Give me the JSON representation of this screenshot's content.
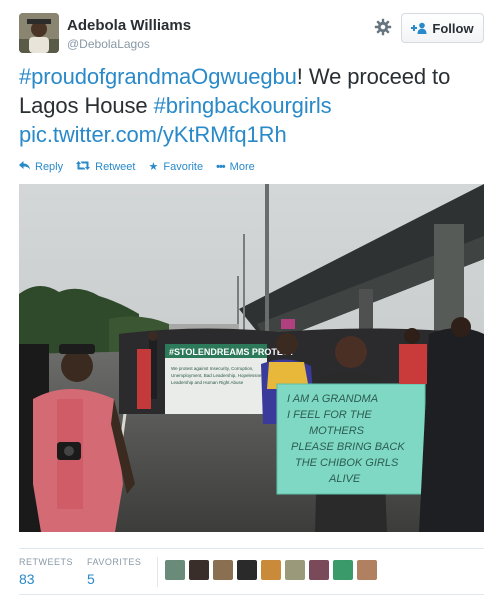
{
  "user": {
    "name": "Adebola Williams",
    "handle": "@DebolaLagos"
  },
  "follow_button": {
    "label": "Follow"
  },
  "tweet": {
    "parts": [
      {
        "text": "#proudofgrandmaOgwuegbu",
        "link": true
      },
      {
        "text": "! We proceed to Lagos House ",
        "link": false
      },
      {
        "text": "#bringbackourgirls",
        "link": true
      },
      {
        "text": " ",
        "link": false
      },
      {
        "text": "pic.twitter.com/yKtRMfq1Rh",
        "link": true
      }
    ]
  },
  "actions": {
    "reply": "Reply",
    "retweet": "Retweet",
    "favorite": "Favorite",
    "more": "More"
  },
  "photo": {
    "banner_text": "#STOLENDREAMS PROTEST",
    "banner_subtext": [
      "We protest against Insecurity, Corruption,",
      "Unemployment, Bad Leadership, Hopelessness",
      "Leadership and Human Right Abuse"
    ],
    "placard_text": [
      "I AM A GRANDMA",
      "I FEEL FOR THE",
      "MOTHERS",
      "PLEASE BRING BACK",
      "THE CHIBOK GIRLS",
      "ALIVE"
    ]
  },
  "stats": {
    "retweets_label": "RETWEETS",
    "retweets_count": "83",
    "favorites_label": "FAVORITES",
    "favorites_count": "5"
  },
  "favoriters": [
    {
      "color": "#6a8a7a"
    },
    {
      "color": "#3a2e2a"
    },
    {
      "color": "#8a7050"
    },
    {
      "color": "#2a2a2a"
    },
    {
      "color": "#c98a3a"
    },
    {
      "color": "#9a9a7a"
    },
    {
      "color": "#7a4a5a"
    },
    {
      "color": "#3a9a6a"
    },
    {
      "color": "#b08060"
    }
  ],
  "colors": {
    "link": "#2a8ac9",
    "text": "#292f33",
    "muted": "#8899a6",
    "placard": "#7ed8c4"
  }
}
